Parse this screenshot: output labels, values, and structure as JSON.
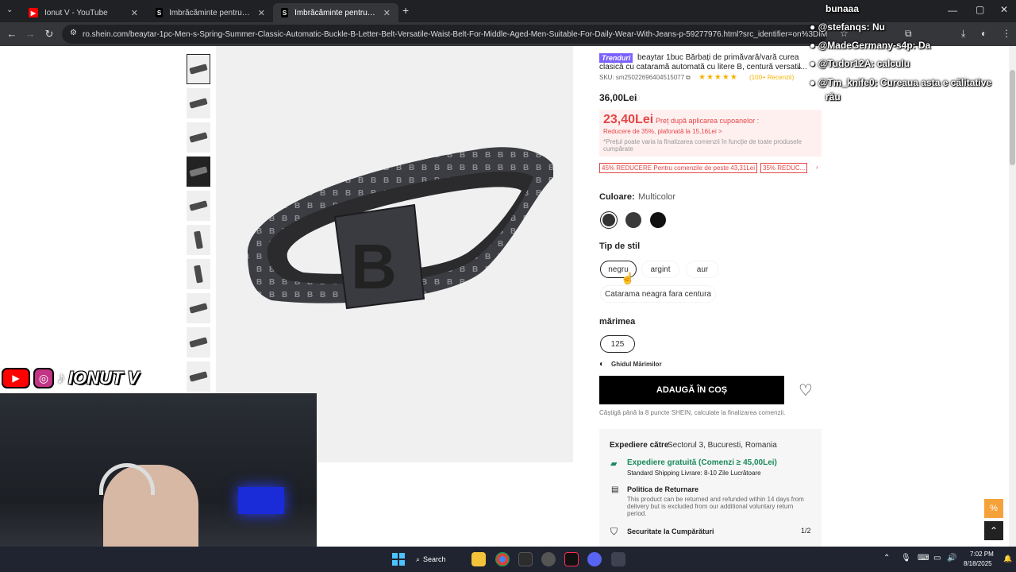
{
  "browser": {
    "tabs": [
      {
        "title": "Ionut V - YouTube",
        "favicon": "youtube-icon"
      },
      {
        "title": "Îmbrăcăminte pentru femei și b",
        "favicon": "shein-icon"
      },
      {
        "title": "Îmbrăcăminte pentru femei și b",
        "favicon": "shein-icon"
      }
    ],
    "new_tab": "+",
    "url": "ro.shein.com/beaytar-1pc-Men-s-Spring-Summer-Classic-Automatic-Buckle-B-Letter-Belt-Versatile-Waist-Belt-For-Middle-Aged-Men-Suitable-For-Daily-Wear-With-Jeans-p-59277976.html?src_identifier=on%3DIMAGE_COMPO..."
  },
  "product": {
    "brand_badge": "Trenduri",
    "title_line1": "beaytar 1buc Bărbați de primăvară/vară curea",
    "title_line2": "clasică cu cataramă automată cu litere B, centură versatil...",
    "sku": "SKU: sm25022696404515077",
    "rating_stars": "★★★★★",
    "reviews": "(100+ Recenzii)",
    "price": "36,00Lei",
    "promo": {
      "price": "23,40Lei",
      "label": "Preț după aplicarea cupoanelor :",
      "discount": "Reducere de 35%, plafonată la 15,16Lei >",
      "note_line1": "*Prețul poate varia la finalizarea comenzii în funcție de toate produsele",
      "note_line2": "cumpărate"
    },
    "coupons": [
      "45% REDUCERE Pentru comenzile de peste 43,31Lei",
      "35% REDUC..."
    ],
    "color_label": "Culoare:",
    "color_value": "Multicolor",
    "style_label": "Tip de stil",
    "styles": [
      "negru",
      "argint",
      "aur",
      "Catarama neagra fara centura"
    ],
    "size_label": "mărimea",
    "sizes": [
      "125"
    ],
    "size_guide": "Ghidul Mărimilor",
    "add_to_cart": "ADAUGĂ ÎN COȘ",
    "points_note": "Câștigă până la 8 puncte SHEIN, calculate la finalizarea comenzii."
  },
  "shipping": {
    "label": "Expediere către",
    "location": "Sectorul 3, Bucuresti, Romania",
    "free_shipping": "Expediere gratuită (Comenzi ≥ 45,00Lei)",
    "standard": "Standard Shipping Livrare: 8-10 Zile Lucrătoare",
    "returns_title": "Politica de Returnare",
    "returns_line1": "This product can be returned and refunded within 14 days from",
    "returns_line2": "delivery but is excluded from our additional voluntary return",
    "returns_line3": "period.",
    "security_title": "Securitate la Cumpărături",
    "security_pager": "1/2"
  },
  "stream": {
    "channel_name": "IONUT V",
    "chat_header": "bunaaa",
    "chat": [
      {
        "user": "@stefanqs:",
        "msg": "Nu"
      },
      {
        "user": "@MadeGermany-s4p:",
        "msg": "Da"
      },
      {
        "user": "@Tudor12A:",
        "msg": "calculu"
      },
      {
        "user": "@Tm_knife0:",
        "msg": "Cureaua asta e călitative"
      },
      {
        "user": "",
        "msg": "rău"
      }
    ]
  },
  "taskbar": {
    "search": "Search",
    "time": "7:02 PM",
    "date": "8/18/2025"
  },
  "colors": {
    "promo_red": "#e64545",
    "promo_bg": "#fff0f0",
    "cart_black": "#000000",
    "rating_gold": "#f4b400"
  }
}
